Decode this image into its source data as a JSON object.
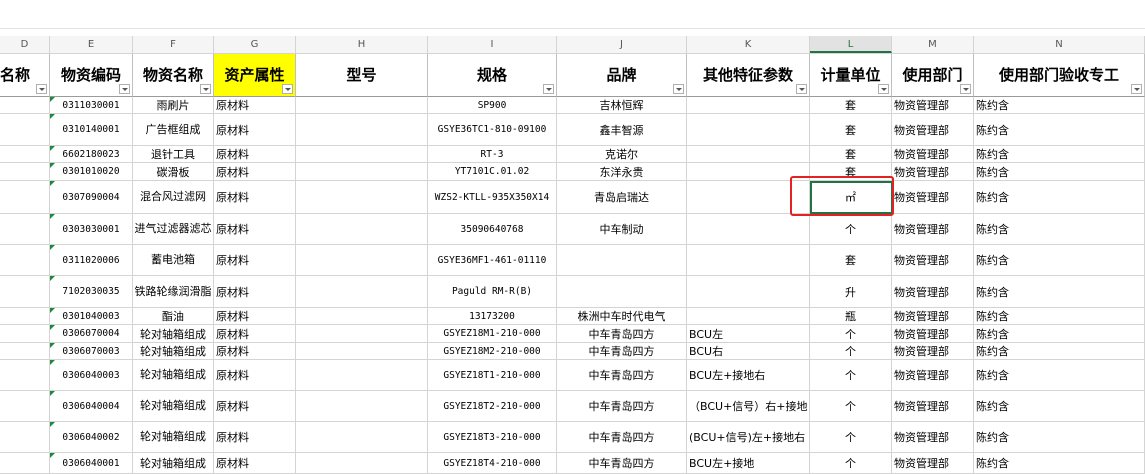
{
  "columns": {
    "d": "D",
    "e": "E",
    "f": "F",
    "g": "G",
    "h": "H",
    "i": "I",
    "j": "J",
    "k": "K",
    "l": "L",
    "m": "M",
    "n": "N"
  },
  "headers": {
    "d": "名称",
    "e": "物资编码",
    "f": "物资名称",
    "g": "资产属性",
    "h": "型号",
    "i": "规格",
    "j": "品牌",
    "k": "其他特征参数",
    "l": "计量单位",
    "m": "使用部门",
    "n": "使用部门验收专工"
  },
  "rows": [
    {
      "code": "0311030001",
      "name": "雨刷片",
      "attr": "原材料",
      "spec": "SP900",
      "brand": "吉林恒辉",
      "other": "",
      "unit": "套",
      "dept": "物资管理部",
      "person": "陈约含"
    },
    {
      "code": "0310140001",
      "name": "广告框组成",
      "attr": "原材料",
      "spec": "GSYE36TC1-810-09100",
      "brand": "鑫丰智源",
      "other": "",
      "unit": "套",
      "dept": "物资管理部",
      "person": "陈约含"
    },
    {
      "code": "6602180023",
      "name": "退针工具",
      "attr": "原材料",
      "spec": "RT-3",
      "brand": "克诺尔",
      "other": "",
      "unit": "套",
      "dept": "物资管理部",
      "person": "陈约含"
    },
    {
      "code": "0301010020",
      "name": "碳滑板",
      "attr": "原材料",
      "spec": "YT7101C.01.02",
      "brand": "东洋永贵",
      "other": "",
      "unit": "套",
      "dept": "物资管理部",
      "person": "陈约含"
    },
    {
      "code": "0307090004",
      "name": "混合风过滤网",
      "attr": "原材料",
      "spec": "WZS2-KTLL-935X350X14",
      "brand": "青岛启瑞达",
      "other": "",
      "unit": "㎡",
      "dept": "物资管理部",
      "person": "陈约含"
    },
    {
      "code": "0303030001",
      "name": "进气过滤器滤芯",
      "attr": "原材料",
      "spec": "35090640768",
      "brand": "中车制动",
      "other": "",
      "unit": "个",
      "dept": "物资管理部",
      "person": "陈约含"
    },
    {
      "code": "0311020006",
      "name": "蓄电池箱",
      "attr": "原材料",
      "spec": "GSYE36MF1-461-01110",
      "brand": "",
      "other": "",
      "unit": "套",
      "dept": "物资管理部",
      "person": "陈约含"
    },
    {
      "code": "7102030035",
      "name": "铁路轮缘润滑脂",
      "attr": "原材料",
      "spec": "Paguld RM-R(B)",
      "brand": "",
      "other": "",
      "unit": "升",
      "dept": "物资管理部",
      "person": "陈约含"
    },
    {
      "code": "0301040003",
      "name": "酯油",
      "attr": "原材料",
      "spec": "13173200",
      "brand": "株洲中车时代电气",
      "other": "",
      "unit": "瓶",
      "dept": "物资管理部",
      "person": "陈约含"
    },
    {
      "code": "0306070004",
      "name": "轮对轴箱组成",
      "attr": "原材料",
      "spec": "GSYEZ18M1-210-000",
      "brand": "中车青岛四方",
      "other": "BCU左",
      "unit": "个",
      "dept": "物资管理部",
      "person": "陈约含"
    },
    {
      "code": "0306070003",
      "name": "轮对轴箱组成",
      "attr": "原材料",
      "spec": "GSYEZ18M2-210-000",
      "brand": "中车青岛四方",
      "other": "BCU右",
      "unit": "个",
      "dept": "物资管理部",
      "person": "陈约含"
    },
    {
      "code": "0306040003",
      "name": "轮对轴箱组成",
      "attr": "原材料",
      "spec": "GSYEZ18T1-210-000",
      "brand": "中车青岛四方",
      "other": "BCU左+接地右",
      "unit": "个",
      "dept": "物资管理部",
      "person": "陈约含"
    },
    {
      "code": "0306040004",
      "name": "轮对轴箱组成",
      "attr": "原材料",
      "spec": "GSYEZ18T2-210-000",
      "brand": "中车青岛四方",
      "other": "（BCU+信号）右+接地",
      "unit": "个",
      "dept": "物资管理部",
      "person": "陈约含"
    },
    {
      "code": "0306040002",
      "name": "轮对轴箱组成",
      "attr": "原材料",
      "spec": "GSYEZ18T3-210-000",
      "brand": "中车青岛四方",
      "other": "(BCU+信号)左+接地右",
      "unit": "个",
      "dept": "物资管理部",
      "person": "陈约含"
    },
    {
      "code": "0306040001",
      "name": "轮对轴箱组成",
      "attr": "原材料",
      "spec": "GSYEZ18T4-210-000",
      "brand": "中车青岛四方",
      "other": "BCU左+接地",
      "unit": "个",
      "dept": "物资管理部",
      "person": "陈约含"
    }
  ]
}
